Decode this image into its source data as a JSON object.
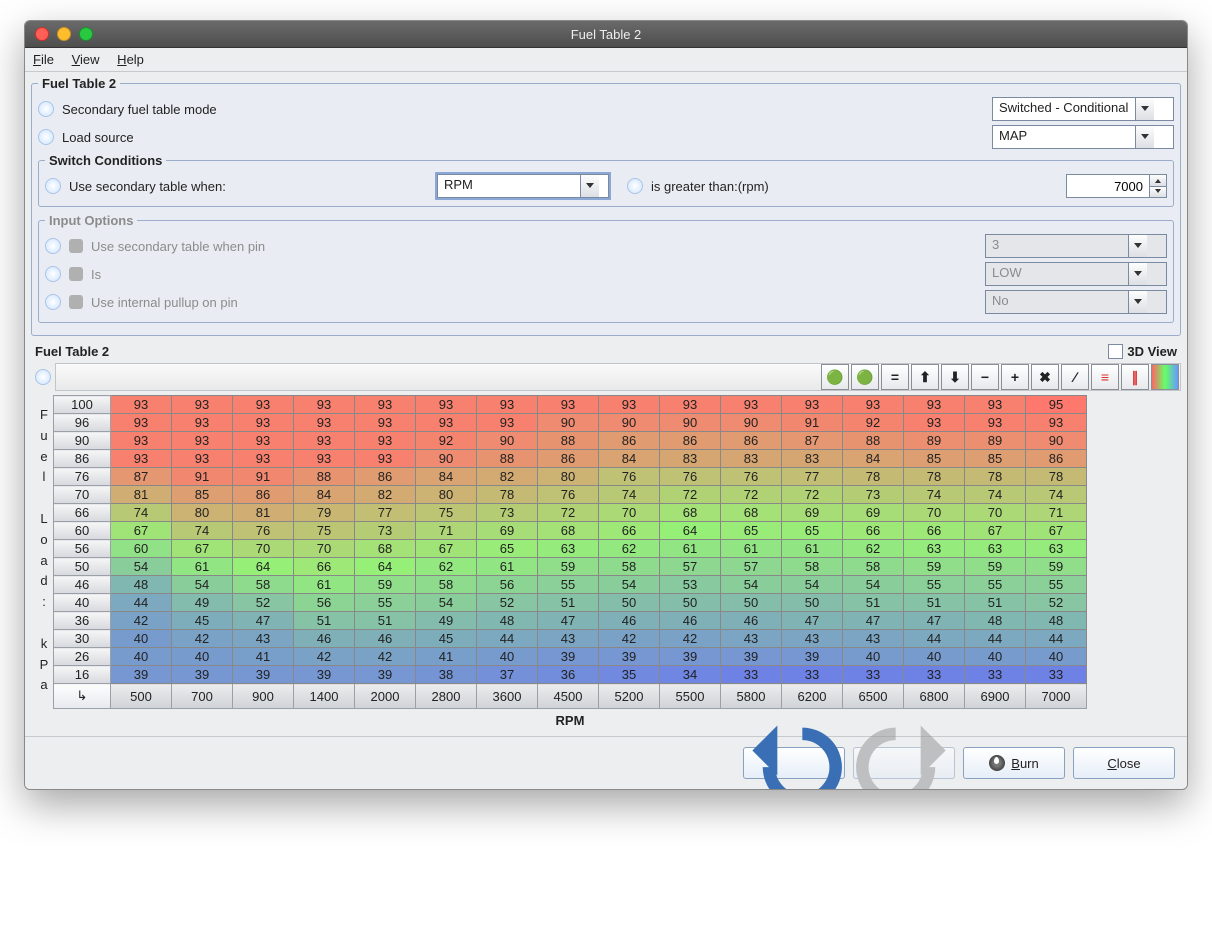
{
  "title": "Fuel Table 2",
  "menu": {
    "file": "File",
    "view": "View",
    "help": "Help"
  },
  "fs1": {
    "legend": "Fuel Table 2",
    "row1_label": "Secondary fuel table mode",
    "row1_value": "Switched - Conditional",
    "row2_label": "Load source",
    "row2_value": "MAP"
  },
  "switch": {
    "legend": "Switch Conditions",
    "label": "Use secondary table when:",
    "var": "RPM",
    "op": "is greater than:(rpm)",
    "val": "7000"
  },
  "input": {
    "legend": "Input Options",
    "r1": "Use secondary table when pin",
    "v1": "3",
    "r2": "Is",
    "v2": "LOW",
    "r3": "Use internal pullup on pin",
    "v3": "No"
  },
  "table": {
    "title": "Fuel Table 2",
    "view3d": "3D View",
    "yaxis": "Fuel Load: kPa",
    "xaxis": "RPM"
  },
  "chart_data": {
    "type": "heatmap",
    "xlabel": "RPM",
    "ylabel": "Fuel Load: kPa",
    "x": [
      500,
      700,
      900,
      1400,
      2000,
      2800,
      3600,
      4500,
      5200,
      5500,
      5800,
      6200,
      6500,
      6800,
      6900,
      7000
    ],
    "y": [
      100,
      96,
      90,
      86,
      76,
      70,
      66,
      60,
      56,
      50,
      46,
      40,
      36,
      30,
      26,
      16
    ],
    "z": [
      [
        93,
        93,
        93,
        93,
        93,
        93,
        93,
        93,
        93,
        93,
        93,
        93,
        93,
        93,
        93,
        95
      ],
      [
        93,
        93,
        93,
        93,
        93,
        93,
        93,
        90,
        90,
        90,
        90,
        91,
        92,
        93,
        93,
        93
      ],
      [
        93,
        93,
        93,
        93,
        93,
        92,
        90,
        88,
        86,
        86,
        86,
        87,
        88,
        89,
        89,
        90
      ],
      [
        93,
        93,
        93,
        93,
        93,
        90,
        88,
        86,
        84,
        83,
        83,
        83,
        84,
        85,
        85,
        86
      ],
      [
        87,
        91,
        91,
        88,
        86,
        84,
        82,
        80,
        76,
        76,
        76,
        77,
        78,
        78,
        78,
        78
      ],
      [
        81,
        85,
        86,
        84,
        82,
        80,
        78,
        76,
        74,
        72,
        72,
        72,
        73,
        74,
        74,
        74
      ],
      [
        74,
        80,
        81,
        79,
        77,
        75,
        73,
        72,
        70,
        68,
        68,
        69,
        69,
        70,
        70,
        71
      ],
      [
        67,
        74,
        76,
        75,
        73,
        71,
        69,
        68,
        66,
        64,
        65,
        65,
        66,
        66,
        67,
        67
      ],
      [
        60,
        67,
        70,
        70,
        68,
        67,
        65,
        63,
        62,
        61,
        61,
        61,
        62,
        63,
        63,
        63
      ],
      [
        54,
        61,
        64,
        66,
        64,
        62,
        61,
        59,
        58,
        57,
        57,
        58,
        58,
        59,
        59,
        59
      ],
      [
        48,
        54,
        58,
        61,
        59,
        58,
        56,
        55,
        54,
        53,
        54,
        54,
        54,
        55,
        55,
        55
      ],
      [
        44,
        49,
        52,
        56,
        55,
        54,
        52,
        51,
        50,
        50,
        50,
        50,
        51,
        51,
        51,
        52
      ],
      [
        42,
        45,
        47,
        51,
        51,
        49,
        48,
        47,
        46,
        46,
        46,
        47,
        47,
        47,
        48,
        48
      ],
      [
        40,
        42,
        43,
        46,
        46,
        45,
        44,
        43,
        42,
        42,
        43,
        43,
        43,
        44,
        44,
        44
      ],
      [
        40,
        40,
        41,
        42,
        42,
        41,
        40,
        39,
        39,
        39,
        39,
        39,
        40,
        40,
        40,
        40
      ],
      [
        39,
        39,
        39,
        39,
        39,
        38,
        37,
        36,
        35,
        34,
        33,
        33,
        33,
        33,
        33,
        33
      ]
    ]
  },
  "footer": {
    "burn": "Burn",
    "close": "Close"
  }
}
